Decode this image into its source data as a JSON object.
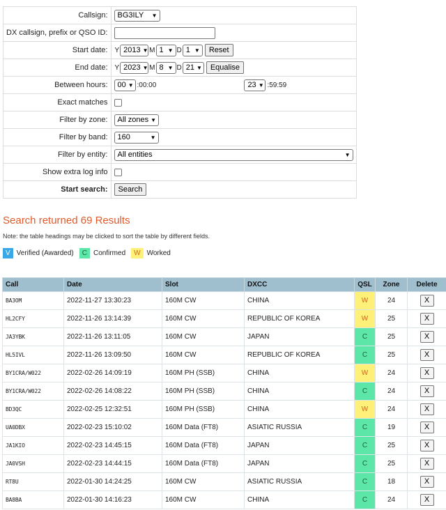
{
  "form": {
    "callsign": {
      "label": "Callsign:",
      "value": "BG3ILY"
    },
    "dx": {
      "label": "DX callsign, prefix or QSO ID:",
      "value": ""
    },
    "start_date": {
      "label": "Start date:",
      "y_prefix": "Y",
      "year": "2013",
      "m_prefix": "M",
      "month": "1",
      "d_prefix": "D",
      "day": "1",
      "button": "Reset"
    },
    "end_date": {
      "label": "End date:",
      "y_prefix": "Y",
      "year": "2023",
      "m_prefix": "M",
      "month": "8",
      "d_prefix": "D",
      "day": "21",
      "button": "Equalise"
    },
    "hours": {
      "label": "Between hours:",
      "start_hour": "00",
      "start_rest": ":00:00",
      "end_hour": "23",
      "end_rest": ":59:59"
    },
    "exact": {
      "label": "Exact matches",
      "checked": false
    },
    "zone": {
      "label": "Filter by zone:",
      "value": "All zones"
    },
    "band": {
      "label": "Filter by band:",
      "value": "160"
    },
    "entity": {
      "label": "Filter by entity:",
      "value": "All entities"
    },
    "extra": {
      "label": "Show extra log info",
      "checked": false
    },
    "search": {
      "label": "Start search:",
      "button": "Search"
    }
  },
  "results": {
    "title": "Search returned 69 Results",
    "note": "Note: the table headings may be clicked to sort the table by different fields.",
    "legend": [
      {
        "code": "V",
        "text": "Verified (Awarded)",
        "color": "#3aa8e6"
      },
      {
        "code": "C",
        "text": "Confirmed",
        "color": "#5ce6a8"
      },
      {
        "code": "W",
        "text": "Worked",
        "color": "#fff07a"
      }
    ],
    "columns": [
      "Call",
      "Date",
      "Slot",
      "DXCC",
      "QSL",
      "Zone",
      "Delete"
    ],
    "rows": [
      {
        "call": "BA3OM",
        "date": "2022-11-27 13:30:23",
        "slot": "160M CW",
        "dxcc": "CHINA",
        "qsl": "W",
        "zone": "24",
        "del": "X"
      },
      {
        "call": "HL2CFY",
        "date": "2022-11-26 13:14:39",
        "slot": "160M CW",
        "dxcc": "REPUBLIC OF KOREA",
        "qsl": "W",
        "zone": "25",
        "del": "X"
      },
      {
        "call": "JA3YBK",
        "date": "2022-11-26 13:11:05",
        "slot": "160M CW",
        "dxcc": "JAPAN",
        "qsl": "C",
        "zone": "25",
        "del": "X"
      },
      {
        "call": "HL5IVL",
        "date": "2022-11-26 13:09:50",
        "slot": "160M CW",
        "dxcc": "REPUBLIC OF KOREA",
        "qsl": "C",
        "zone": "25",
        "del": "X"
      },
      {
        "call": "BY1CRA/W022",
        "date": "2022-02-26 14:09:19",
        "slot": "160M PH (SSB)",
        "dxcc": "CHINA",
        "qsl": "W",
        "zone": "24",
        "del": "X"
      },
      {
        "call": "BY1CRA/W022",
        "date": "2022-02-26 14:08:22",
        "slot": "160M PH (SSB)",
        "dxcc": "CHINA",
        "qsl": "C",
        "zone": "24",
        "del": "X"
      },
      {
        "call": "BD3QC",
        "date": "2022-02-25 12:32:51",
        "slot": "160M PH (SSB)",
        "dxcc": "CHINA",
        "qsl": "W",
        "zone": "24",
        "del": "X"
      },
      {
        "call": "UA0DBX",
        "date": "2022-02-23 15:10:02",
        "slot": "160M Data (FT8)",
        "dxcc": "ASIATIC RUSSIA",
        "qsl": "C",
        "zone": "19",
        "del": "X"
      },
      {
        "call": "JA1KIO",
        "date": "2022-02-23 14:45:15",
        "slot": "160M Data (FT8)",
        "dxcc": "JAPAN",
        "qsl": "C",
        "zone": "25",
        "del": "X"
      },
      {
        "call": "JA0VSH",
        "date": "2022-02-23 14:44:15",
        "slot": "160M Data (FT8)",
        "dxcc": "JAPAN",
        "qsl": "C",
        "zone": "25",
        "del": "X"
      },
      {
        "call": "RT8U",
        "date": "2022-01-30 14:24:25",
        "slot": "160M CW",
        "dxcc": "ASIATIC RUSSIA",
        "qsl": "C",
        "zone": "18",
        "del": "X"
      },
      {
        "call": "BA8BA",
        "date": "2022-01-30 14:16:23",
        "slot": "160M CW",
        "dxcc": "CHINA",
        "qsl": "C",
        "zone": "24",
        "del": "X"
      }
    ]
  }
}
